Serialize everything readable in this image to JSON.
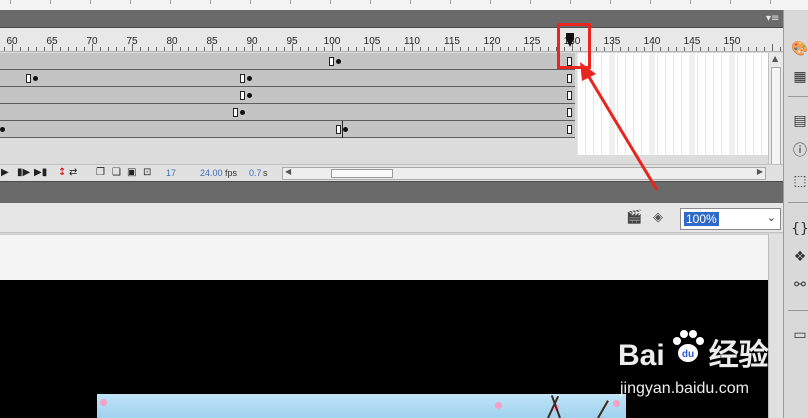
{
  "timeline": {
    "ruler_labels": [
      "60",
      "65",
      "70",
      "75",
      "80",
      "85",
      "90",
      "95",
      "100",
      "105",
      "110",
      "115",
      "120",
      "125",
      "130",
      "135",
      "140",
      "145",
      "150"
    ],
    "current_frame": "17",
    "frame_rate": "24.00",
    "frame_rate_unit": "fps",
    "elapsed_time": "0.7",
    "elapsed_time_unit": "s"
  },
  "icons": {
    "panel_menu": "panel-menu-icon",
    "playback": [
      "play-icon",
      "step-forward-icon",
      "go-to-last-frame-icon"
    ],
    "onion": [
      "center-frame-icon",
      "loop-icon",
      "onion-skin-icon",
      "onion-skin-outlines-icon",
      "edit-multiple-frames-icon",
      "modify-onion-markers-icon"
    ],
    "edit_bar": [
      "edit-scene-icon",
      "edit-symbols-icon"
    ],
    "dock": [
      "color-swatches-icon",
      "align-icon",
      "library-icon",
      "info-icon",
      "transform-icon",
      "code-snippets-icon",
      "components-icon",
      "motion-presets-icon",
      "project-icon"
    ]
  },
  "stage": {
    "zoom": "100%"
  },
  "watermark": {
    "brand": "Bai",
    "brand_tail": "经验",
    "url": "jingyan.baidu.com"
  },
  "colors": {
    "annotation": "#e8261f",
    "selection": "#3169c6",
    "stage": "#000000"
  }
}
